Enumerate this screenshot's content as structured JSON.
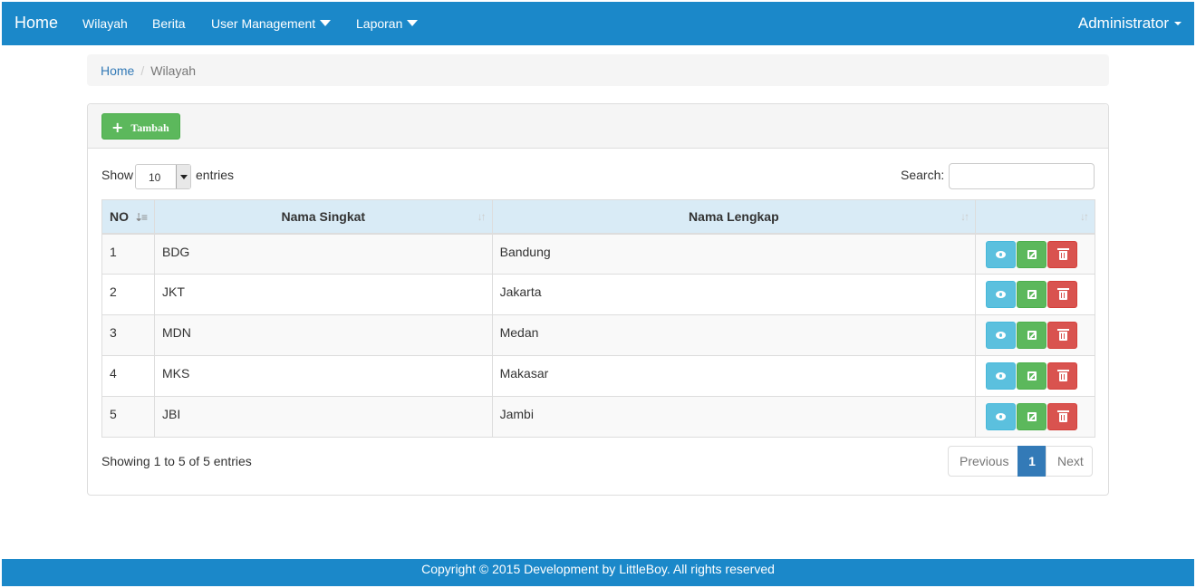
{
  "navbar": {
    "brand": "Home",
    "items": [
      "Wilayah",
      "Berita",
      "User Management",
      "Laporan"
    ],
    "user": "Administrator"
  },
  "breadcrumb": {
    "home": "Home",
    "current": "Wilayah"
  },
  "toolbar": {
    "add_label": "Tambah"
  },
  "length": {
    "show": "Show",
    "value": "10",
    "entries": "entries"
  },
  "search": {
    "label": "Search:",
    "value": ""
  },
  "table": {
    "headers": [
      "NO",
      "Nama Singkat",
      "Nama Lengkap",
      ""
    ],
    "rows": [
      {
        "no": "1",
        "singkat": "BDG",
        "lengkap": "Bandung"
      },
      {
        "no": "2",
        "singkat": "JKT",
        "lengkap": "Jakarta"
      },
      {
        "no": "3",
        "singkat": "MDN",
        "lengkap": "Medan"
      },
      {
        "no": "4",
        "singkat": "MKS",
        "lengkap": "Makasar"
      },
      {
        "no": "5",
        "singkat": "JBI",
        "lengkap": "Jambi"
      }
    ]
  },
  "info": "Showing 1 to 5 of 5 entries",
  "pagination": {
    "previous": "Previous",
    "current": "1",
    "next": "Next"
  },
  "footer": "Copyright © 2015 Development by LittleBoy. All rights reserved",
  "colors": {
    "navbar": "#1b88c9",
    "header_row": "#d9ebf6",
    "view": "#5bc0de",
    "edit": "#5cb85c",
    "delete": "#d9534f",
    "page_active": "#337ab7"
  },
  "icons": {
    "add": "plus-icon",
    "view": "eye-icon",
    "edit": "edit-icon",
    "delete": "trash-icon",
    "sort": "sort-icon"
  }
}
